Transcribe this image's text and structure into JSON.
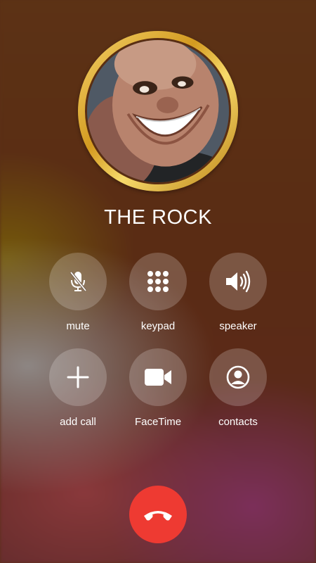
{
  "contact": {
    "name": "THE ROCK"
  },
  "buttons": {
    "mute": {
      "label": "mute",
      "icon": "mic-slash-icon"
    },
    "keypad": {
      "label": "keypad",
      "icon": "keypad-icon"
    },
    "speaker": {
      "label": "speaker",
      "icon": "speaker-icon"
    },
    "add_call": {
      "label": "add call",
      "icon": "plus-icon"
    },
    "facetime": {
      "label": "FaceTime",
      "icon": "video-camera-icon"
    },
    "contacts": {
      "label": "contacts",
      "icon": "person-circle-icon"
    }
  },
  "end_call": {
    "icon": "phone-hangup-icon",
    "color": "#ee3a32"
  },
  "colors": {
    "avatar_ring": "#d9a52a",
    "button_fill": "rgba(255,255,255,0.20)"
  }
}
